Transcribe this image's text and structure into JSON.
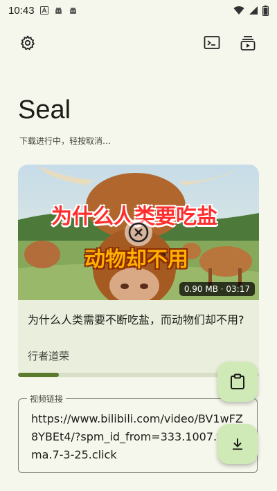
{
  "status_bar": {
    "time": "10:43",
    "notification_icons": [
      "a-icon",
      "android-icon",
      "android-icon"
    ],
    "system_icons": [
      "wifi-icon",
      "signal-icon",
      "battery-icon"
    ]
  },
  "toolbar": {
    "settings_icon": "gear-icon",
    "terminal_icon": "terminal-icon",
    "queue_icon": "playlist-icon"
  },
  "header": {
    "title": "Seal",
    "subtitle": "下载进行中，轻按取消…"
  },
  "video_card": {
    "thumbnail_text_line1": "为什么人类要吃盐",
    "thumbnail_text_line2": "动物却不用",
    "badge": "0.90 MB · 03:17",
    "title": "为什么人类需要不断吃盐，而动物们却不用?",
    "uploader": "行者道荣",
    "progress": 0.17
  },
  "url_field": {
    "label": "视频链接",
    "value": "https://www.bilibili.com/video/BV1wFZ8YBEt4/?spm_id_from=333.1007.tianma.7-3-25.click"
  },
  "fabs": {
    "paste_icon": "clipboard-icon",
    "download_icon": "download-icon"
  },
  "colors": {
    "background": "#f6f7ec",
    "card": "#eaeedd",
    "accent": "#5a7a2e",
    "fab": "#cfeab7"
  }
}
